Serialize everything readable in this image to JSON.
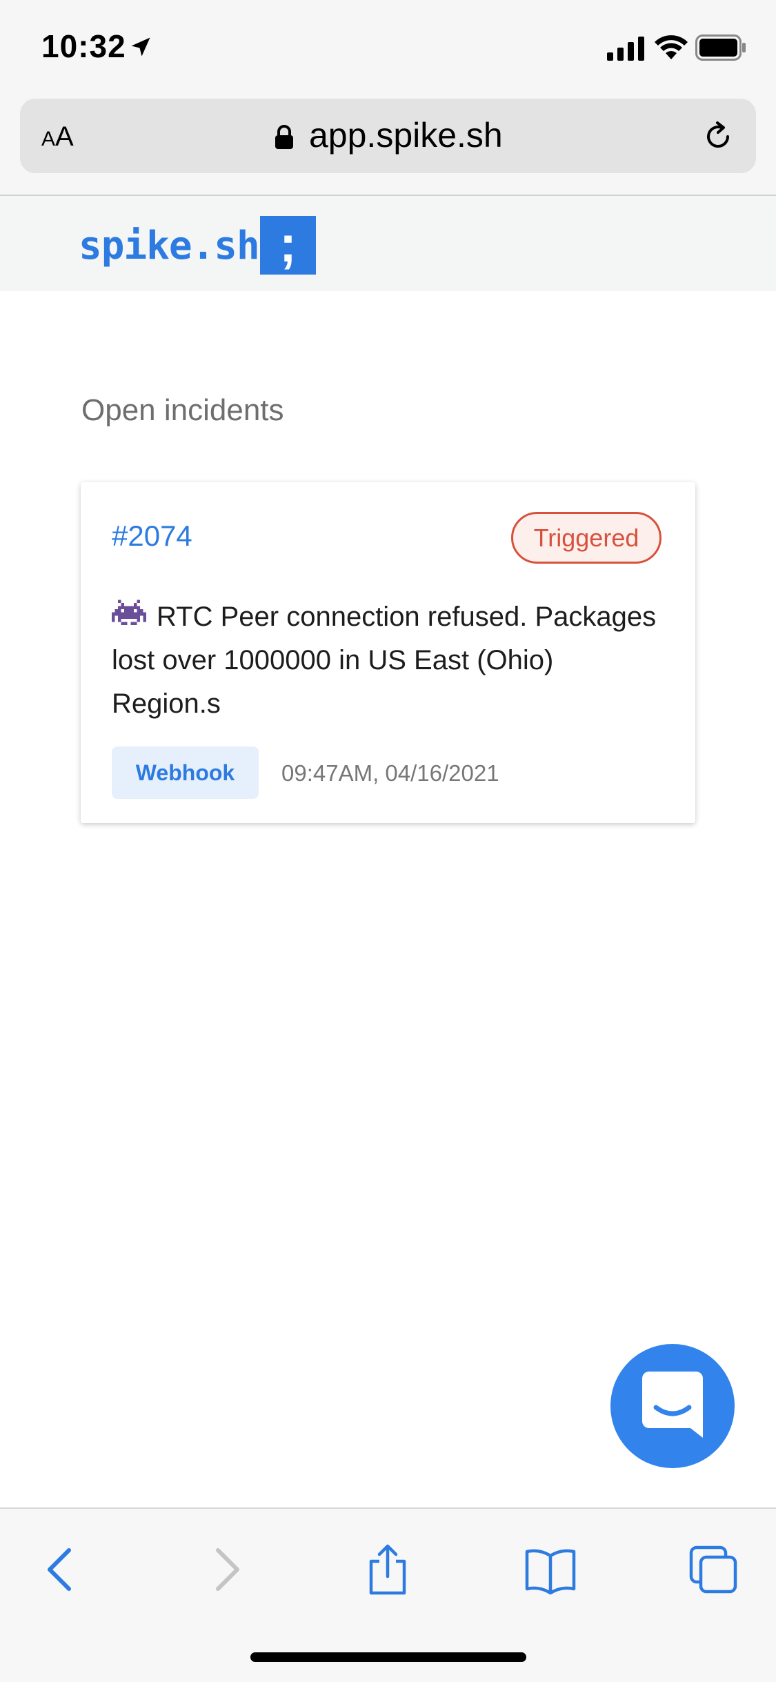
{
  "status_bar": {
    "time": "10:32"
  },
  "browser": {
    "text_size_label_small": "A",
    "text_size_label_large": "A",
    "url": "app.spike.sh"
  },
  "app": {
    "brand_name": "spike.sh",
    "brand_mark": ";"
  },
  "main": {
    "section_title": "Open incidents",
    "incidents": [
      {
        "id": "#2074",
        "status": "Triggered",
        "message": "RTC Peer connection refused. Packages lost over 1000000 in US East (Ohio) Region.s",
        "source": "Webhook",
        "timestamp": "09:47AM, 04/16/2021"
      }
    ]
  },
  "colors": {
    "accent": "#2d7be0",
    "status_triggered": "#d8513c",
    "chat_fab": "#3283ec"
  },
  "icons": {
    "emoji": "space-invader-icon",
    "toolbar": [
      "back-icon",
      "forward-icon",
      "share-icon",
      "bookmarks-icon",
      "tabs-icon"
    ]
  }
}
